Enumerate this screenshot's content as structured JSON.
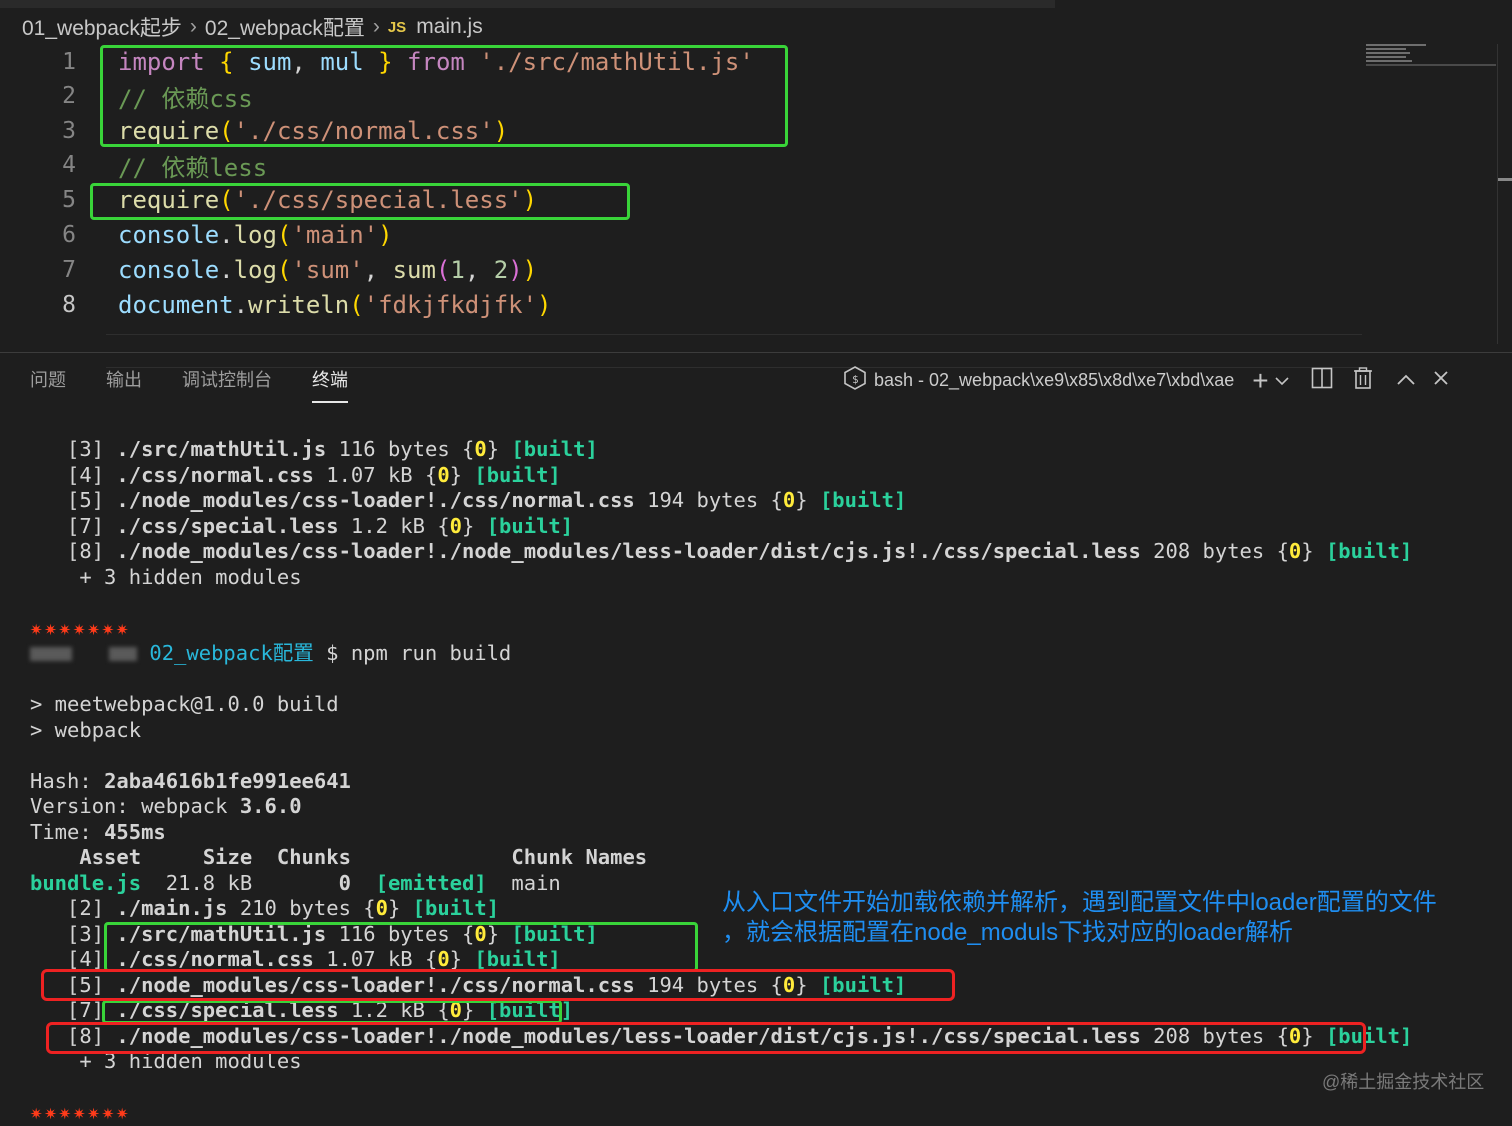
{
  "breadcrumb": {
    "folder1": "01_webpack起步",
    "folder2": "02_webpack配置",
    "file_icon": "JS",
    "file": "main.js"
  },
  "editor": {
    "lines": [
      {
        "num": "1"
      },
      {
        "num": "2"
      },
      {
        "num": "3"
      },
      {
        "num": "4"
      },
      {
        "num": "5"
      },
      {
        "num": "6"
      },
      {
        "num": "7"
      },
      {
        "num": "8"
      }
    ],
    "code": {
      "l1_import": "import",
      "l1_open": "{",
      "l1_sum": "sum",
      "l1_comma": ",",
      "l1_mul": "mul",
      "l1_close": "}",
      "l1_from": "from",
      "l1_path": "'./src/mathUtil.js'",
      "l2_comment": "// 依赖css",
      "l3_fn": "require",
      "l3_open": "(",
      "l3_path": "'./css/normal.css'",
      "l3_close": ")",
      "l4_comment": "// 依赖less",
      "l5_fn": "require",
      "l5_open": "(",
      "l5_path": "'./css/special.less'",
      "l5_close": ")",
      "l6_obj": "console",
      "l6_dot": ".",
      "l6_fn": "log",
      "l6_open": "(",
      "l6_str": "'main'",
      "l6_close": ")",
      "l7_obj": "console",
      "l7_dot": ".",
      "l7_fn": "log",
      "l7_open": "(",
      "l7_str": "'sum'",
      "l7_comma": ",",
      "l7_fn2": "sum",
      "l7_open2": "(",
      "l7_n1": "1",
      "l7_comma2": ",",
      "l7_n2": "2",
      "l7_close2": ")",
      "l7_close": ")",
      "l8_obj": "document",
      "l8_dot": ".",
      "l8_fn": "writeln",
      "l8_open": "(",
      "l8_str": "'fdkjfkdjfk'",
      "l8_close": ")"
    }
  },
  "panel": {
    "tabs": [
      "问题",
      "输出",
      "调试控制台",
      "终端"
    ],
    "active_tab": "终端",
    "terminal_name": "bash - 02_webpack\\xe9\\x85\\x8d\\xe7\\xbd\\xae"
  },
  "terminal": {
    "first_build": [
      {
        "id": "[3]",
        "path": "./src/mathUtil.js",
        "size": "116 bytes",
        "chunk": "0",
        "status": "[built]"
      },
      {
        "id": "[4]",
        "path": "./css/normal.css",
        "size": "1.07 kB",
        "chunk": "0",
        "status": "[built]"
      },
      {
        "id": "[5]",
        "path": "./node_modules/css-loader!./css/normal.css",
        "size": "194 bytes",
        "chunk": "0",
        "status": "[built]"
      },
      {
        "id": "[7]",
        "path": "./css/special.less",
        "size": "1.2 kB",
        "chunk": "0",
        "status": "[built]"
      },
      {
        "id": "[8]",
        "path": "./node_modules/css-loader!./node_modules/less-loader/dist/cjs.js!./css/special.less",
        "size": "208 bytes",
        "chunk": "0",
        "status": "[built]"
      }
    ],
    "hidden_modules": "+ 3 hidden modules",
    "stars": "✷✷✷✷✷✷✷",
    "prompt_dir": "02_webpack配置",
    "prompt_cmd": "$ npm run build",
    "script_line1": "> meetwebpack@1.0.0 build",
    "script_line2": "> webpack",
    "hash_label": "Hash:",
    "hash_value": "2aba4616b1fe991ee641",
    "version_label": "Version: webpack",
    "version_value": "3.6.0",
    "time_label": "Time:",
    "time_value": "455ms",
    "table_header": {
      "asset": "Asset",
      "size": "Size",
      "chunks": "Chunks",
      "chunk_names": "Chunk Names"
    },
    "bundle": {
      "name": "bundle.js",
      "size": "21.8 kB",
      "chunk": "0",
      "status": "[emitted]",
      "chunk_name": "main"
    },
    "second_build": [
      {
        "id": "[2]",
        "path": "./main.js",
        "size": "210 bytes",
        "chunk": "0",
        "status": "[built]"
      },
      {
        "id": "[3]",
        "path": "./src/mathUtil.js",
        "size": "116 bytes",
        "chunk": "0",
        "status": "[built]"
      },
      {
        "id": "[4]",
        "path": "./css/normal.css",
        "size": "1.07 kB",
        "chunk": "0",
        "status": "[built]"
      },
      {
        "id": "[5]",
        "path": "./node_modules/css-loader!./css/normal.css",
        "size": "194 bytes",
        "chunk": "0",
        "status": "[built]"
      },
      {
        "id": "[7]",
        "path": "./css/special.less",
        "size": "1.2 kB",
        "chunk": "0",
        "status": "[built]"
      },
      {
        "id": "[8]",
        "path": "./node_modules/css-loader!./node_modules/less-loader/dist/cjs.js!./css/special.less",
        "size": "208 bytes",
        "chunk": "0",
        "status": "[built]"
      }
    ],
    "hidden_modules2": "+ 3 hidden modules",
    "stars2": "✷✷✷✷✷✷✷"
  },
  "annotation": {
    "line1": "从入口文件开始加载依赖并解析，遇到配置文件中loader配置的文件",
    "line2": "，就会根据配置在node_moduls下找对应的loader解析"
  },
  "watermark": "@稀土掘金技术社区",
  "colors": {
    "highlight_green": "#39d439",
    "highlight_red": "#ee2222",
    "annotation_blue": "#1f8ef1"
  }
}
